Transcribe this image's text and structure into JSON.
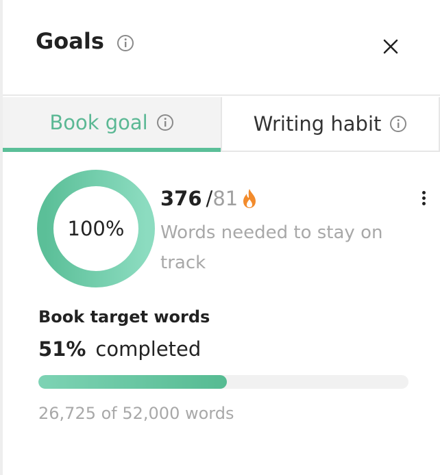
{
  "header": {
    "title": "Goals"
  },
  "tabs": [
    {
      "label": "Book goal",
      "active": true
    },
    {
      "label": "Writing habit",
      "active": false
    }
  ],
  "session": {
    "ring_percent_label": "100%",
    "ring_fraction": 1.0,
    "words_current": "376",
    "separator": "/",
    "words_target": "81",
    "description": "Words needed to stay on track"
  },
  "book_target": {
    "label": "Book target words",
    "percent_label": "51%",
    "completed_text": "completed",
    "progress_fraction": 0.51,
    "words_summary": "26,725 of 52,000 words"
  },
  "colors": {
    "accent": "#5bbf98",
    "accent_light": "#7dd3b4",
    "flame": "#f28b2c",
    "muted_text": "#a8a8a8"
  },
  "icons": {
    "title_info": "info-icon",
    "close": "close-icon",
    "tab_info": "info-icon",
    "streak": "flame-icon",
    "more": "more-vertical-icon"
  }
}
